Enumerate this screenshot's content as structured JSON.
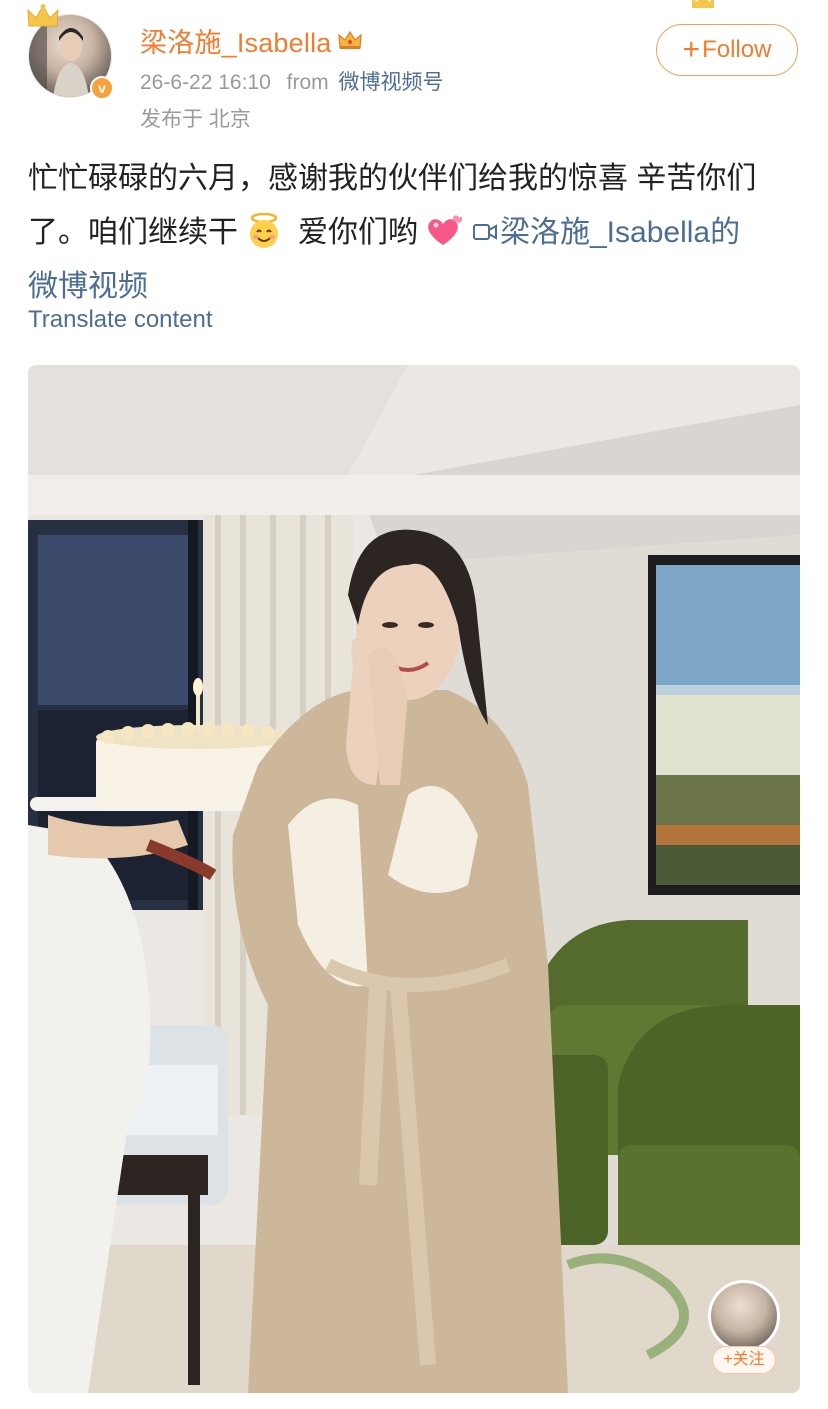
{
  "post": {
    "username": "梁洛施_Isabella",
    "date": "26-6-22 16:10",
    "from_label": "from",
    "source": "微博视频号",
    "location": "发布于 北京",
    "follow_label": "Follow",
    "text_line1": "忙忙碌碌的六月，感谢我的伙伴们给我的惊喜 辛苦你们",
    "text_line2a": "了。咱们继续干",
    "text_line2b": "爱你们哟",
    "link_text_a": "梁洛施_Isabella的",
    "link_text_b": "微博视频",
    "translate_label": "Translate content",
    "pip_follow_label": "+关注"
  },
  "icons": {
    "avatar": "user-avatar",
    "badge": "verified-badge",
    "crown": "crown-icon",
    "emoji1": "angel-emoji",
    "emoji2": "hearts-emoji",
    "video": "video-camera-icon"
  },
  "colors": {
    "username": "#f57c2f",
    "link": "#4e6d93",
    "meta": "#9a9a9a",
    "text": "#222222"
  }
}
